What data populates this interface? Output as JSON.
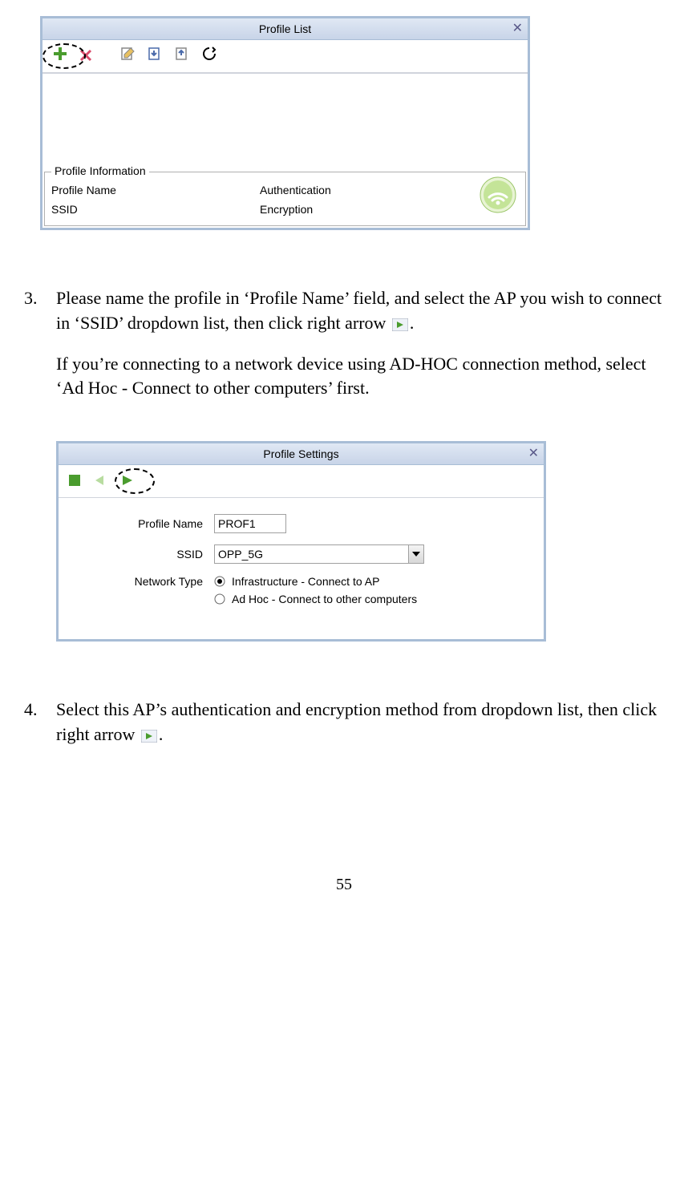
{
  "window1": {
    "title": "Profile List",
    "info_legend": "Profile Information",
    "labels": {
      "profile_name": "Profile Name",
      "ssid": "SSID",
      "authentication": "Authentication",
      "encryption": "Encryption"
    }
  },
  "step3": {
    "num": "3.",
    "p1a": "Please name the profile in ‘Profile Name’ field, and select the AP you wish to connect in ‘SSID’ dropdown list, then click right arrow",
    "p1b": ".",
    "p2": "If you’re connecting to a network device using AD-HOC connection method, select ‘Ad Hoc - Connect to other computers’ first."
  },
  "window2": {
    "title": "Profile Settings",
    "labels": {
      "profile_name": "Profile Name",
      "ssid": "SSID",
      "network_type": "Network Type"
    },
    "profile_name_value": "PROF1",
    "ssid_value": "OPP_5G",
    "radio1": "Infrastructure - Connect to AP",
    "radio2": "Ad Hoc - Connect to other computers"
  },
  "step4": {
    "num": "4.",
    "p1a": "Select this AP’s authentication and encryption method from dropdown list, then click right arrow",
    "p1b": "."
  },
  "page_number": "55"
}
